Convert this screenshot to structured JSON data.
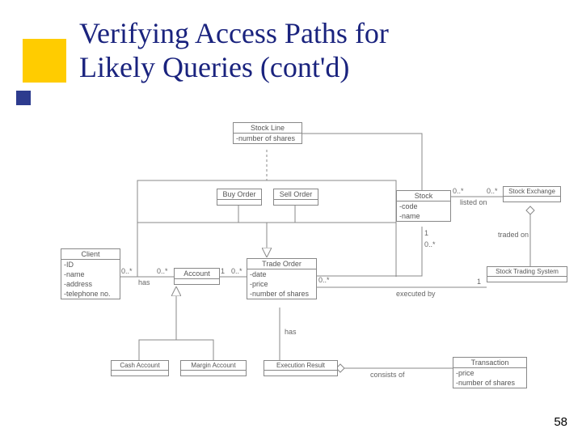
{
  "title_line1": "Verifying Access Paths for",
  "title_line2": "Likely Queries (cont'd)",
  "page_number": "58",
  "classes": {
    "stock_line": {
      "name": "Stock Line",
      "attrs": [
        "-number of shares"
      ]
    },
    "buy_order": {
      "name": "Buy Order"
    },
    "sell_order": {
      "name": "Sell Order"
    },
    "stock": {
      "name": "Stock",
      "attrs": [
        "-code",
        "-name"
      ]
    },
    "stock_exchange": {
      "name": "Stock Exchange"
    },
    "client": {
      "name": "Client",
      "attrs": [
        "-ID",
        "-name",
        "-address",
        "-telephone no."
      ]
    },
    "account": {
      "name": "Account"
    },
    "trade_order": {
      "name": "Trade Order",
      "attrs": [
        "-date",
        "-price",
        "-number of shares"
      ]
    },
    "stock_trading_system": {
      "name": "Stock Trading System"
    },
    "cash_account": {
      "name": "Cash Account"
    },
    "margin_account": {
      "name": "Margin Account"
    },
    "execution_result": {
      "name": "Execution Result"
    },
    "transaction": {
      "name": "Transaction",
      "attrs": [
        "-price",
        "-number of shares"
      ]
    }
  },
  "labels": {
    "has1": "has",
    "has2": "has",
    "listed_on": "listed on",
    "traded_on": "traded on",
    "executed_by": "executed by",
    "consists_of": "consists of",
    "m_0s_a": "0..*",
    "m_0s_b": "0..*",
    "m_1_a": "1",
    "m_0s_c": "0..*",
    "m_0s_d": "0..*",
    "m_0s_e": "0..*",
    "m_1_b": "1",
    "m_0s_f": "0..*",
    "m_0s_g": "0..*",
    "m_1_c": "1"
  }
}
